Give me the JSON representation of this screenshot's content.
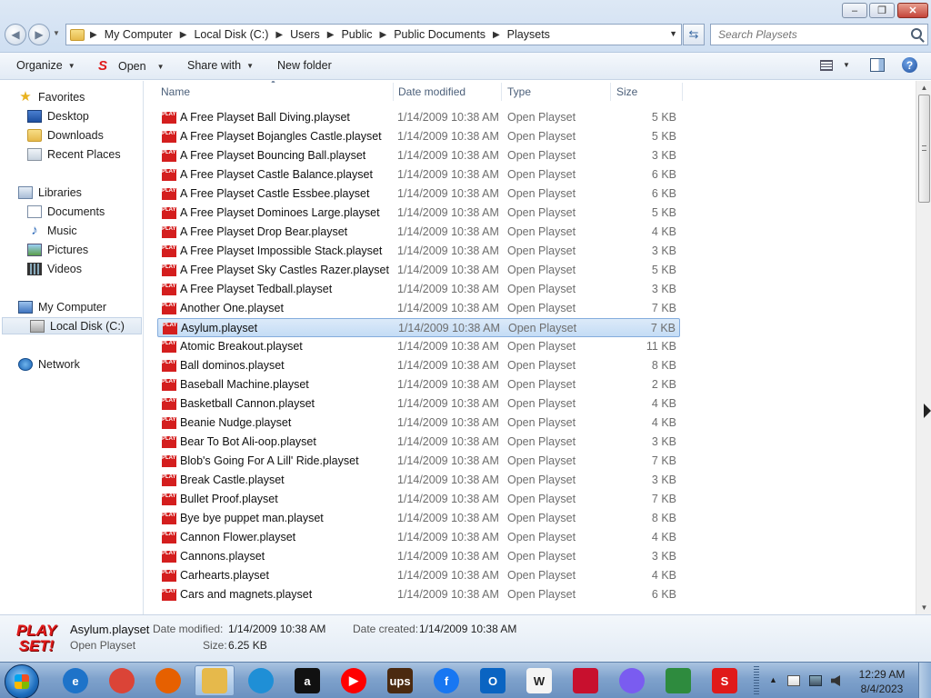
{
  "window": {
    "buttons": {
      "minimize": "–",
      "maximize": "❐",
      "close": "✕"
    }
  },
  "address": {
    "crumbs": [
      "My Computer",
      "Local Disk (C:)",
      "Users",
      "Public",
      "Public Documents",
      "Playsets"
    ],
    "search_placeholder": "Search Playsets"
  },
  "toolbar": {
    "organize": "Organize",
    "open": "Open",
    "share": "Share with",
    "new_folder": "New folder"
  },
  "nav": {
    "favorites": "Favorites",
    "desktop": "Desktop",
    "downloads": "Downloads",
    "recent": "Recent Places",
    "libraries": "Libraries",
    "documents": "Documents",
    "music": "Music",
    "pictures": "Pictures",
    "videos": "Videos",
    "computer": "My Computer",
    "local_disk": "Local Disk (C:)",
    "network": "Network"
  },
  "columns": {
    "name": "Name",
    "date": "Date modified",
    "type": "Type",
    "size": "Size"
  },
  "icon_label": "PLAY SET!",
  "files": [
    {
      "name": "A Free Playset Ball Diving.playset",
      "date": "1/14/2009 10:38 AM",
      "type": "Open Playset",
      "size": "5 KB"
    },
    {
      "name": "A Free Playset Bojangles Castle.playset",
      "date": "1/14/2009 10:38 AM",
      "type": "Open Playset",
      "size": "5 KB"
    },
    {
      "name": "A Free Playset Bouncing Ball.playset",
      "date": "1/14/2009 10:38 AM",
      "type": "Open Playset",
      "size": "3 KB"
    },
    {
      "name": "A Free Playset Castle Balance.playset",
      "date": "1/14/2009 10:38 AM",
      "type": "Open Playset",
      "size": "6 KB"
    },
    {
      "name": "A Free Playset Castle Essbee.playset",
      "date": "1/14/2009 10:38 AM",
      "type": "Open Playset",
      "size": "6 KB"
    },
    {
      "name": "A Free Playset Dominoes Large.playset",
      "date": "1/14/2009 10:38 AM",
      "type": "Open Playset",
      "size": "5 KB"
    },
    {
      "name": "A Free Playset Drop Bear.playset",
      "date": "1/14/2009 10:38 AM",
      "type": "Open Playset",
      "size": "4 KB"
    },
    {
      "name": "A Free Playset Impossible Stack.playset",
      "date": "1/14/2009 10:38 AM",
      "type": "Open Playset",
      "size": "3 KB"
    },
    {
      "name": "A Free Playset Sky Castles Razer.playset",
      "date": "1/14/2009 10:38 AM",
      "type": "Open Playset",
      "size": "5 KB"
    },
    {
      "name": "A Free Playset Tedball.playset",
      "date": "1/14/2009 10:38 AM",
      "type": "Open Playset",
      "size": "3 KB"
    },
    {
      "name": "Another One.playset",
      "date": "1/14/2009 10:38 AM",
      "type": "Open Playset",
      "size": "7 KB"
    },
    {
      "name": "Asylum.playset",
      "date": "1/14/2009 10:38 AM",
      "type": "Open Playset",
      "size": "7 KB",
      "selected": true
    },
    {
      "name": "Atomic Breakout.playset",
      "date": "1/14/2009 10:38 AM",
      "type": "Open Playset",
      "size": "11 KB"
    },
    {
      "name": "Ball dominos.playset",
      "date": "1/14/2009 10:38 AM",
      "type": "Open Playset",
      "size": "8 KB"
    },
    {
      "name": "Baseball Machine.playset",
      "date": "1/14/2009 10:38 AM",
      "type": "Open Playset",
      "size": "2 KB"
    },
    {
      "name": "Basketball Cannon.playset",
      "date": "1/14/2009 10:38 AM",
      "type": "Open Playset",
      "size": "4 KB"
    },
    {
      "name": "Beanie Nudge.playset",
      "date": "1/14/2009 10:38 AM",
      "type": "Open Playset",
      "size": "4 KB"
    },
    {
      "name": "Bear To Bot Ali-oop.playset",
      "date": "1/14/2009 10:38 AM",
      "type": "Open Playset",
      "size": "3 KB"
    },
    {
      "name": "Blob's Going For A Lill' Ride.playset",
      "date": "1/14/2009 10:38 AM",
      "type": "Open Playset",
      "size": "7 KB"
    },
    {
      "name": "Break Castle.playset",
      "date": "1/14/2009 10:38 AM",
      "type": "Open Playset",
      "size": "3 KB"
    },
    {
      "name": "Bullet Proof.playset",
      "date": "1/14/2009 10:38 AM",
      "type": "Open Playset",
      "size": "7 KB"
    },
    {
      "name": "Bye bye puppet man.playset",
      "date": "1/14/2009 10:38 AM",
      "type": "Open Playset",
      "size": "8 KB"
    },
    {
      "name": "Cannon Flower.playset",
      "date": "1/14/2009 10:38 AM",
      "type": "Open Playset",
      "size": "4 KB"
    },
    {
      "name": "Cannons.playset",
      "date": "1/14/2009 10:38 AM",
      "type": "Open Playset",
      "size": "3 KB"
    },
    {
      "name": "Carhearts.playset",
      "date": "1/14/2009 10:38 AM",
      "type": "Open Playset",
      "size": "4 KB"
    },
    {
      "name": "Cars and magnets.playset",
      "date": "1/14/2009 10:38 AM",
      "type": "Open Playset",
      "size": "6 KB"
    }
  ],
  "details": {
    "name": "Asylum.playset",
    "type": "Open Playset",
    "modified_label": "Date modified:",
    "modified": "1/14/2009 10:38 AM",
    "created_label": "Date created:",
    "created": "1/14/2009 10:38 AM",
    "size_label": "Size:",
    "size": "6.25 KB",
    "logo_text": "PLAY SET!"
  },
  "taskbar": {
    "apps": [
      {
        "name": "internet-explorer",
        "glyph": "e",
        "color": "#1e73c9"
      },
      {
        "name": "chrome",
        "glyph": "",
        "color": "#db4437"
      },
      {
        "name": "firefox",
        "glyph": "",
        "color": "#e66000"
      },
      {
        "name": "file-explorer",
        "glyph": "",
        "color": "#e6b94b",
        "active": true
      },
      {
        "name": "edge",
        "glyph": "",
        "color": "#1f8fd6"
      },
      {
        "name": "amazon",
        "glyph": "a",
        "color": "#111111"
      },
      {
        "name": "youtube",
        "glyph": "▶",
        "color": "#ff0000"
      },
      {
        "name": "ups",
        "glyph": "ups",
        "color": "#4b2a10"
      },
      {
        "name": "facebook",
        "glyph": "f",
        "color": "#1877f2"
      },
      {
        "name": "outlook",
        "glyph": "O",
        "color": "#0a64c2"
      },
      {
        "name": "wikipedia",
        "glyph": "W",
        "color": "#f4f4f4"
      },
      {
        "name": "bank-of-america",
        "glyph": "",
        "color": "#c8102e"
      },
      {
        "name": "copilot",
        "glyph": "",
        "color": "#7a5cf0"
      },
      {
        "name": "store",
        "glyph": "",
        "color": "#2e8b3e"
      },
      {
        "name": "playset",
        "glyph": "S",
        "color": "#e01a1a"
      }
    ],
    "time": "12:29 AM",
    "date": "8/4/2023"
  }
}
